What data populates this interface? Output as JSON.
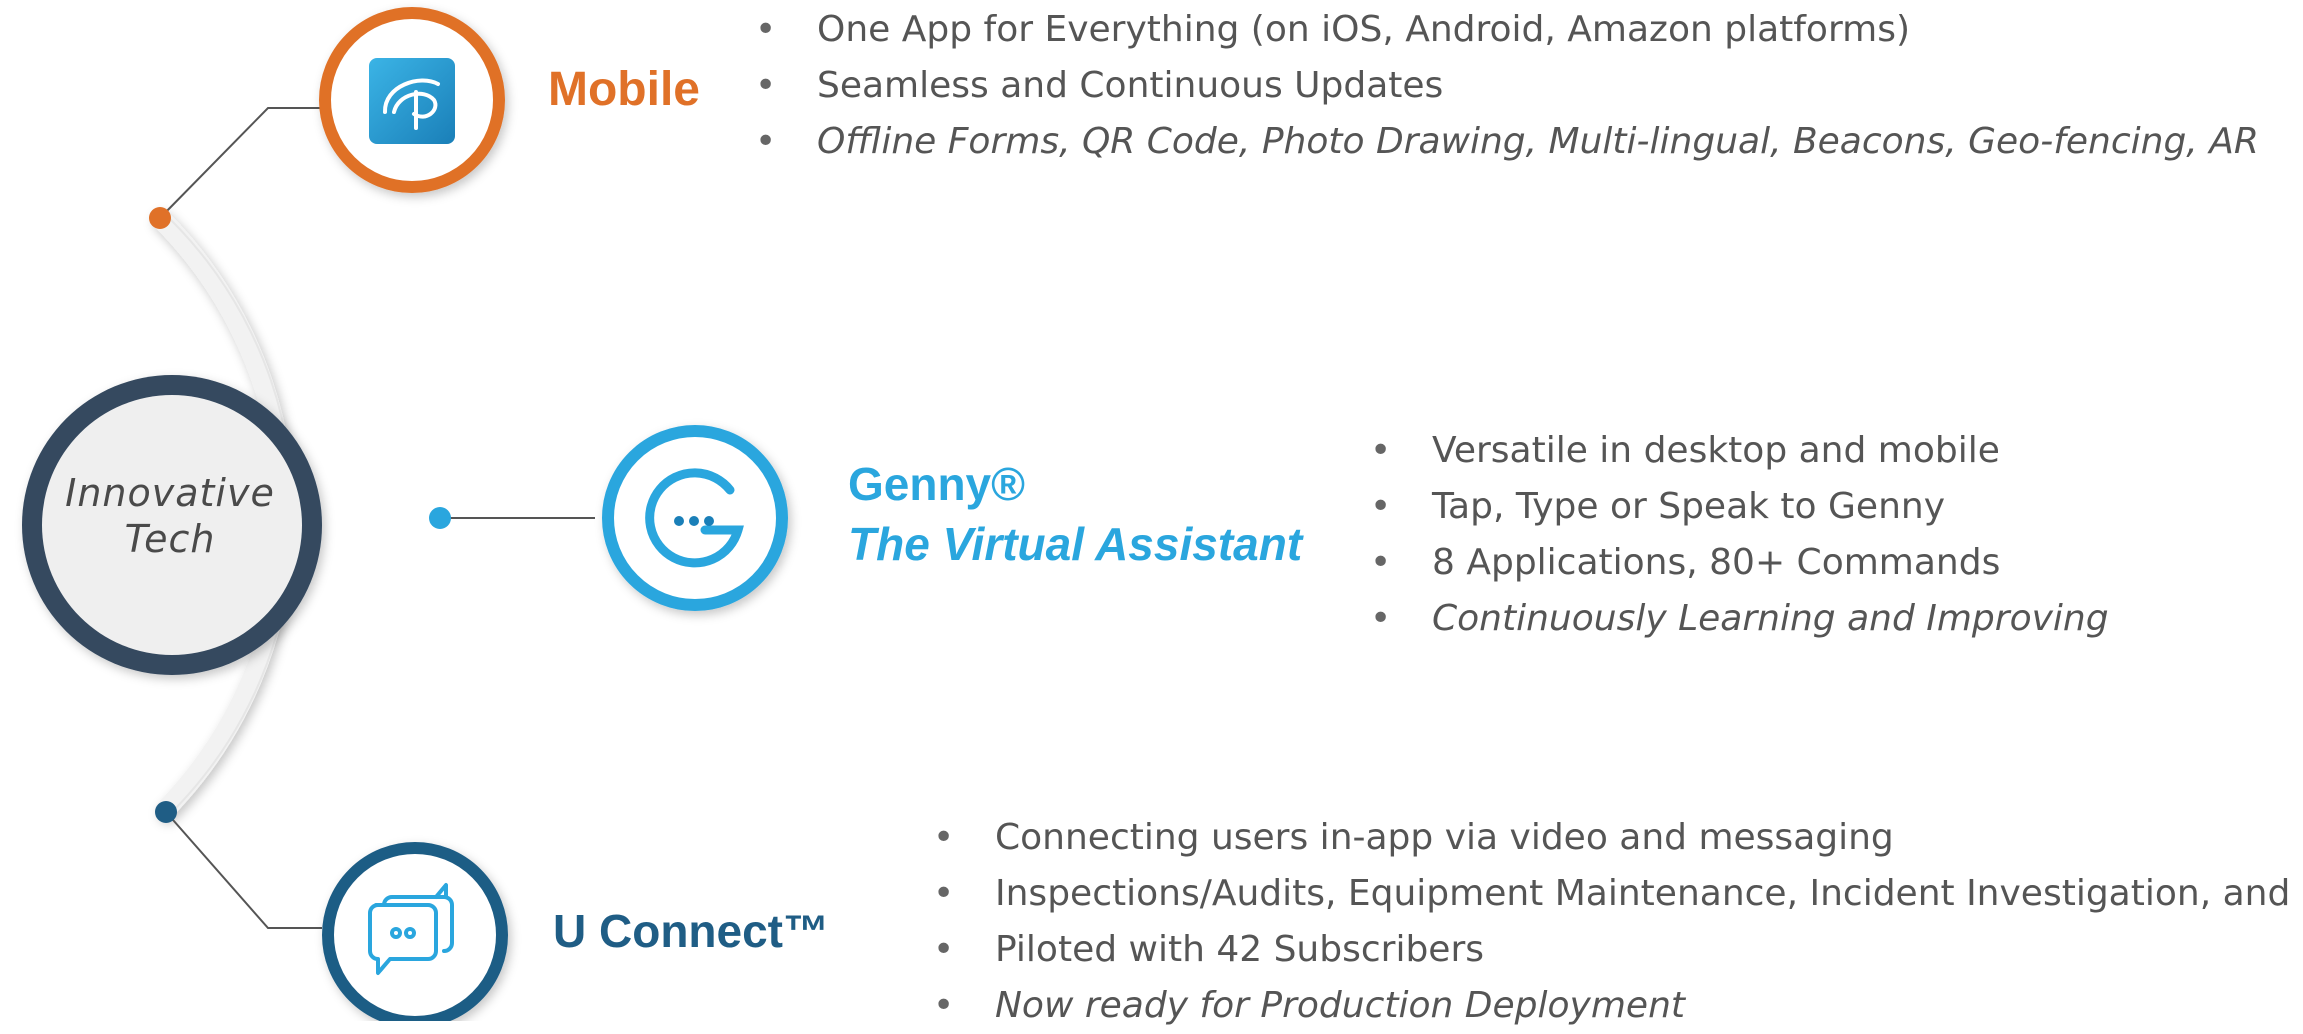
{
  "hub": {
    "line1": "Innovative",
    "line2": "Tech"
  },
  "mobile": {
    "title": "Mobile",
    "bullets": [
      {
        "text": "One App for Everything (on iOS, Android, Amazon platforms)",
        "italic": false
      },
      {
        "text": "Seamless and Continuous Updates",
        "italic": false
      },
      {
        "text": "Offline Forms, QR Code, Photo Drawing, Multi-lingual, Beacons, Geo-fencing, AR",
        "italic": true
      }
    ]
  },
  "genny": {
    "title": "Genny®",
    "subtitle": "The Virtual Assistant",
    "bullets": [
      {
        "text": "Versatile in desktop and mobile",
        "italic": false
      },
      {
        "text": "Tap, Type or Speak to Genny",
        "italic": false
      },
      {
        "text": "8 Applications, 80+ Commands",
        "italic": false
      },
      {
        "text": "Continuously Learning and Improving",
        "italic": true
      }
    ]
  },
  "uconnect": {
    "title": "U Connect™",
    "bullets": [
      {
        "text": "Connecting users in-app via video and messaging",
        "italic": false
      },
      {
        "text": "Inspections/Audits, Equipment Maintenance, Incident Investigation, and more",
        "italic": false
      },
      {
        "text": "Piloted with 42 Subscribers",
        "italic": false
      },
      {
        "text": "Now ready for Production Deployment",
        "italic": true
      }
    ]
  },
  "bullet_char": "•",
  "colors": {
    "mobile": "#e07128",
    "genny": "#2aa6de",
    "uconnect": "#1f5d85",
    "hub_ring": "#34485e",
    "arc": "#efefef"
  },
  "icons": {
    "mobile": "app-logo-icon",
    "genny": "genny-assistant-icon",
    "uconnect": "chat-bubbles-icon"
  }
}
